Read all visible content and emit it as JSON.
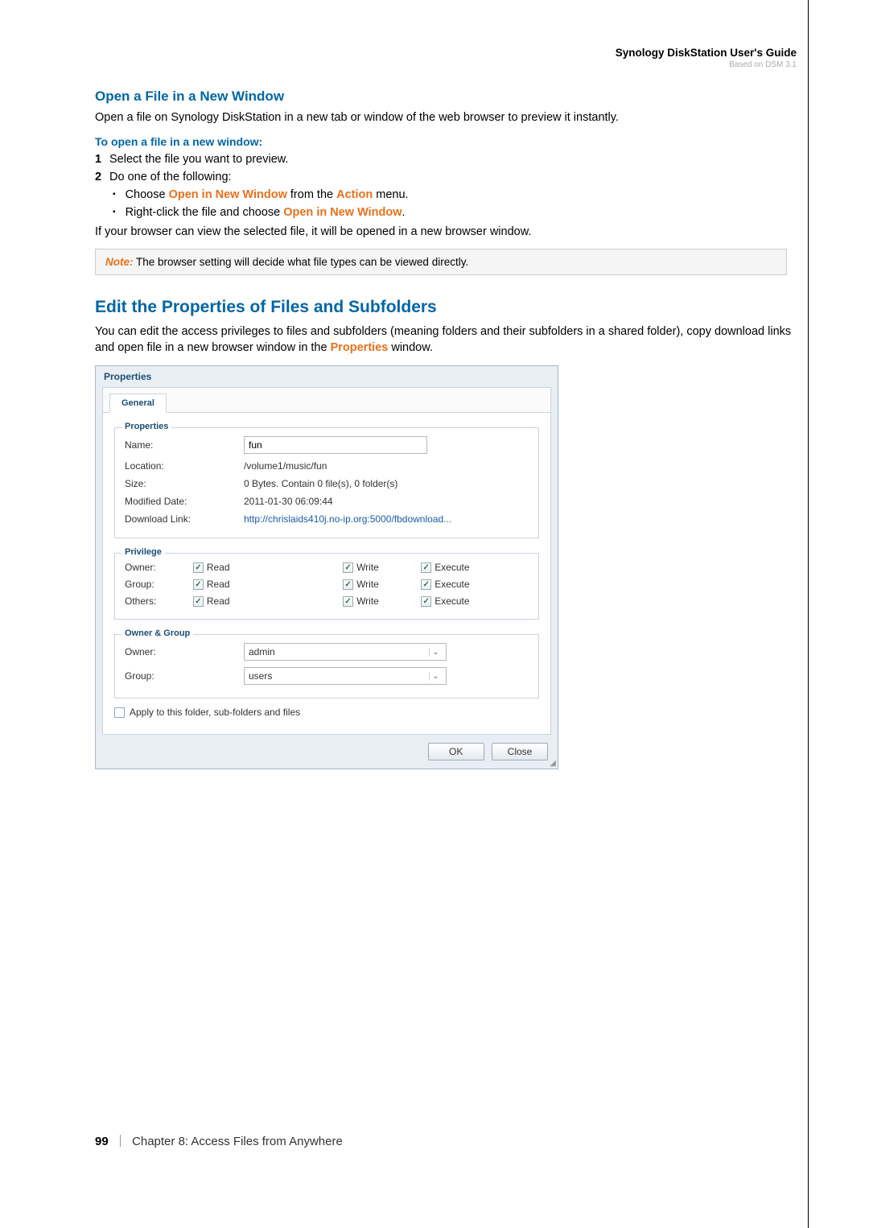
{
  "header": {
    "title": "Synology DiskStation User's Guide",
    "sub": "Based on DSM 3.1"
  },
  "section1": {
    "heading": "Open a File in a New Window",
    "intro": "Open a file on Synology DiskStation in a new tab or window of the web browser to preview it instantly.",
    "subhead": "To open a file in a new window:",
    "step1": "Select the file you want to preview.",
    "step2": "Do one of the following:",
    "bullet1_a": "Choose ",
    "bullet1_b": "Open in New Window",
    "bullet1_c": " from the ",
    "bullet1_d": "Action",
    "bullet1_e": " menu.",
    "bullet2_a": "Right-click the file and choose ",
    "bullet2_b": "Open in New Window",
    "bullet2_c": ".",
    "closing": "If your browser can view the selected file, it will be opened in a new browser window.",
    "note_label": "Note:",
    "note_text": " The browser setting will decide what file types can be viewed directly."
  },
  "section2": {
    "heading": "Edit the Properties of Files and Subfolders",
    "intro_a": "You can edit the access privileges to files and subfolders (meaning folders and their subfolders in a shared folder), copy download links and open file in a new browser window in the ",
    "intro_b": "Properties",
    "intro_c": " window."
  },
  "dialog": {
    "title": "Properties",
    "tab": "General",
    "fieldset1": "Properties",
    "name_label": "Name:",
    "name_value": "fun",
    "location_label": "Location:",
    "location_value": "/volume1/music/fun",
    "size_label": "Size:",
    "size_value": "0 Bytes. Contain 0 file(s), 0 folder(s)",
    "mod_label": "Modified Date:",
    "mod_value": "2011-01-30 06:09:44",
    "dl_label": "Download Link:",
    "dl_value": "http://chrislaids410j.no-ip.org:5000/fbdownload...",
    "fieldset2": "Privilege",
    "priv_owner": "Owner:",
    "priv_group": "Group:",
    "priv_others": "Others:",
    "read": "Read",
    "write": "Write",
    "execute": "Execute",
    "fieldset3": "Owner & Group",
    "og_owner_label": "Owner:",
    "og_owner_value": "admin",
    "og_group_label": "Group:",
    "og_group_value": "users",
    "apply": "Apply to this folder, sub-folders and files",
    "ok": "OK",
    "close": "Close"
  },
  "footer": {
    "page": "99",
    "chapter": "Chapter 8: Access Files from Anywhere"
  }
}
